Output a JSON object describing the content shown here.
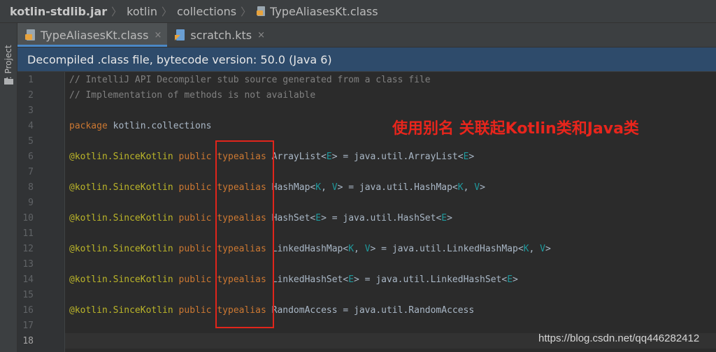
{
  "breadcrumb": {
    "items": [
      {
        "label": "kotlin-stdlib.jar",
        "bold": true
      },
      {
        "label": "kotlin",
        "bold": false
      },
      {
        "label": "collections",
        "bold": false
      },
      {
        "label": "TypeAliasesKt.class",
        "bold": false,
        "icon": "class-file-icon"
      }
    ],
    "separator": "〉"
  },
  "toolstrip": {
    "project_label": "1: Project",
    "folder_icon": "folder-icon"
  },
  "tabs": [
    {
      "label": "TypeAliasesKt.class",
      "icon": "class-file-icon",
      "active": true,
      "close": "×"
    },
    {
      "label": "scratch.kts",
      "icon": "kotlin-script-icon",
      "active": false,
      "close": "×"
    }
  ],
  "banner": {
    "text": "Decompiled .class file, bytecode version: 50.0 (Java 6)"
  },
  "editor": {
    "current_line": 18,
    "lines": [
      {
        "n": "1",
        "tokens": [
          [
            "comment",
            "// IntelliJ API Decompiler stub source generated from a class file"
          ]
        ]
      },
      {
        "n": "2",
        "tokens": [
          [
            "comment",
            "// Implementation of methods is not available"
          ]
        ]
      },
      {
        "n": "3",
        "tokens": []
      },
      {
        "n": "4",
        "tokens": [
          [
            "keyword",
            "package"
          ],
          [
            "text",
            " kotlin.collections"
          ]
        ]
      },
      {
        "n": "5",
        "tokens": []
      },
      {
        "n": "6",
        "tokens": [
          [
            "annot",
            "@kotlin.SinceKotlin"
          ],
          [
            "text",
            " "
          ],
          [
            "keyword",
            "public"
          ],
          [
            "text",
            " "
          ],
          [
            "keyword",
            "typealias"
          ],
          [
            "text",
            " ArrayList<"
          ],
          [
            "tparam",
            "E"
          ],
          [
            "text",
            "> = java.util.ArrayList<"
          ],
          [
            "tparam",
            "E"
          ],
          [
            "text",
            ">"
          ]
        ]
      },
      {
        "n": "7",
        "tokens": []
      },
      {
        "n": "8",
        "tokens": [
          [
            "annot",
            "@kotlin.SinceKotlin"
          ],
          [
            "text",
            " "
          ],
          [
            "keyword",
            "public"
          ],
          [
            "text",
            " "
          ],
          [
            "keyword",
            "typealias"
          ],
          [
            "text",
            " HashMap<"
          ],
          [
            "tparam",
            "K"
          ],
          [
            "text",
            ", "
          ],
          [
            "tparam",
            "V"
          ],
          [
            "text",
            "> = java.util.HashMap<"
          ],
          [
            "tparam",
            "K"
          ],
          [
            "text",
            ", "
          ],
          [
            "tparam",
            "V"
          ],
          [
            "text",
            ">"
          ]
        ]
      },
      {
        "n": "9",
        "tokens": []
      },
      {
        "n": "10",
        "tokens": [
          [
            "annot",
            "@kotlin.SinceKotlin"
          ],
          [
            "text",
            " "
          ],
          [
            "keyword",
            "public"
          ],
          [
            "text",
            " "
          ],
          [
            "keyword",
            "typealias"
          ],
          [
            "text",
            " HashSet<"
          ],
          [
            "tparam",
            "E"
          ],
          [
            "text",
            "> = java.util.HashSet<"
          ],
          [
            "tparam",
            "E"
          ],
          [
            "text",
            ">"
          ]
        ]
      },
      {
        "n": "11",
        "tokens": []
      },
      {
        "n": "12",
        "tokens": [
          [
            "annot",
            "@kotlin.SinceKotlin"
          ],
          [
            "text",
            " "
          ],
          [
            "keyword",
            "public"
          ],
          [
            "text",
            " "
          ],
          [
            "keyword",
            "typealias"
          ],
          [
            "text",
            " LinkedHashMap<"
          ],
          [
            "tparam",
            "K"
          ],
          [
            "text",
            ", "
          ],
          [
            "tparam",
            "V"
          ],
          [
            "text",
            "> = java.util.LinkedHashMap<"
          ],
          [
            "tparam",
            "K"
          ],
          [
            "text",
            ", "
          ],
          [
            "tparam",
            "V"
          ],
          [
            "text",
            ">"
          ]
        ]
      },
      {
        "n": "13",
        "tokens": []
      },
      {
        "n": "14",
        "tokens": [
          [
            "annot",
            "@kotlin.SinceKotlin"
          ],
          [
            "text",
            " "
          ],
          [
            "keyword",
            "public"
          ],
          [
            "text",
            " "
          ],
          [
            "keyword",
            "typealias"
          ],
          [
            "text",
            " LinkedHashSet<"
          ],
          [
            "tparam",
            "E"
          ],
          [
            "text",
            "> = java.util.LinkedHashSet<"
          ],
          [
            "tparam",
            "E"
          ],
          [
            "text",
            ">"
          ]
        ]
      },
      {
        "n": "15",
        "tokens": []
      },
      {
        "n": "16",
        "tokens": [
          [
            "annot",
            "@kotlin.SinceKotlin"
          ],
          [
            "text",
            " "
          ],
          [
            "keyword",
            "public"
          ],
          [
            "text",
            " "
          ],
          [
            "keyword",
            "typealias"
          ],
          [
            "text",
            " RandomAccess = java.util.RandomAccess"
          ]
        ]
      },
      {
        "n": "17",
        "tokens": []
      },
      {
        "n": "18",
        "tokens": []
      }
    ]
  },
  "overlay": {
    "annotation_text": "使用别名  关联起Kotlin类和Java类",
    "annotation_color": "#e8251c",
    "box_color": "#e1251b",
    "watermark": "https://blog.csdn.net/qq446282412"
  },
  "colors": {
    "keyword": "#cc7832",
    "annotation": "#bbb529",
    "comment": "#808080",
    "text": "#a9b7c6",
    "type_param": "#20999d",
    "banner": "#2e4b6b",
    "accent_tab": "#4a88c7"
  }
}
